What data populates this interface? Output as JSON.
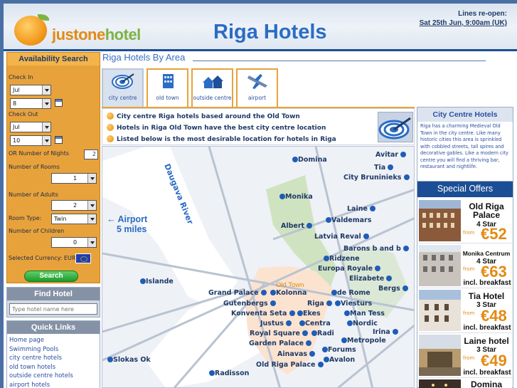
{
  "header": {
    "logo_text_a": "justone",
    "logo_text_b": "hotel",
    "title": "Riga Hotels",
    "reopen_line1": "Lines re-open:",
    "reopen_line2": "Sat 25th Jun, 9:00am (UK)"
  },
  "availability": {
    "title": "Availability Search",
    "check_in_label": "Check In",
    "check_in_month": "Jul",
    "check_in_day": "8",
    "check_out_label": "Check Out",
    "check_out_month": "Jul",
    "check_out_day": "10",
    "nights_label": "OR Number of Nights",
    "nights_value": "2",
    "rooms_label": "Number of Rooms",
    "rooms_value": "1",
    "adults_label": "Number of Adults",
    "adults_value": "2",
    "room_type_label": "Room Type:",
    "room_type_value": "Twin",
    "children_label": "Number of Children",
    "children_value": "0",
    "currency_label": "Selected Currency: EUR",
    "search_label": "Search"
  },
  "find_hotel": {
    "title": "Find Hotel",
    "placeholder": "Type hotel name here"
  },
  "quick_links": {
    "title": "Quick Links",
    "items": [
      "Home page",
      "Swimming Pools",
      "city centre hotels",
      "old town hotels",
      "outside centre hotels",
      "airport hotels"
    ]
  },
  "main": {
    "area_title": "Riga Hotels By Area",
    "tabs": [
      {
        "label": "city centre",
        "icon": "target-icon"
      },
      {
        "label": "old town",
        "icon": "building-icon"
      },
      {
        "label": "outside centre",
        "icon": "houses-icon"
      },
      {
        "label": "airport",
        "icon": "plane-icon"
      }
    ],
    "info": [
      "City centre Riga hotels based around the Old Town",
      "Hotels in Riga Old Town have the best city centre location",
      "Listed below is the most desirable location for hotels in Riga"
    ]
  },
  "map": {
    "river": "Daugava River",
    "airport_line1": "Airport",
    "airport_line2": "5 miles",
    "old_town": "Old Town",
    "hotels": [
      "Domina",
      "Avitar",
      "Tia",
      "City Bruninieks",
      "Monika",
      "Laine",
      "Valdemars",
      "Albert",
      "Latvia Reval",
      "Barons b and b",
      "Ridzene",
      "Europa Royale",
      "Elizabete",
      "Bergs",
      "Islande",
      "Grand Palace",
      "Kolonna",
      "de Rome",
      "Gutenbergs",
      "Riga",
      "Viesturs",
      "Konventa Seta",
      "Ekes",
      "Man Tess",
      "Justus",
      "Centra",
      "Nordic",
      "Royal Square",
      "Radi",
      "Irina",
      "Garden Palace",
      "Metropole",
      "Ainavas",
      "Forums",
      "Slokas Ok",
      "Old Riga Palace",
      "Avalon",
      "Radisson"
    ]
  },
  "city_centre": {
    "title": "City Centre Hotels",
    "text": "Riga has a charming Medieval Old Town in the city centre. Like many historic cities this area is sprinkled with cobbled streets, tall spires and decorative gables. Like a modern city centre you will find a thriving bar, restaurant and nightlife."
  },
  "offers": {
    "title": "Special Offers",
    "items": [
      {
        "name": "Old Riga Palace",
        "stars": "4 Star",
        "from": "from",
        "price": "€52",
        "extra": ""
      },
      {
        "name": "Monika Centrum",
        "stars": "4 Star",
        "from": "from",
        "price": "€63",
        "extra": "incl. breakfast"
      },
      {
        "name": "Tia Hotel",
        "stars": "3 Star",
        "from": "from",
        "price": "€48",
        "extra": "incl. breakfast"
      },
      {
        "name": "Laine hotel",
        "stars": "3 Star",
        "from": "from",
        "price": "€49",
        "extra": "incl. breakfast"
      },
      {
        "name": "Domina",
        "stars": "",
        "from": "",
        "price": "",
        "extra": ""
      }
    ]
  },
  "colors": {
    "accent": "#e8a23b",
    "brand": "#1b4e94",
    "link": "#2b6cc4"
  }
}
